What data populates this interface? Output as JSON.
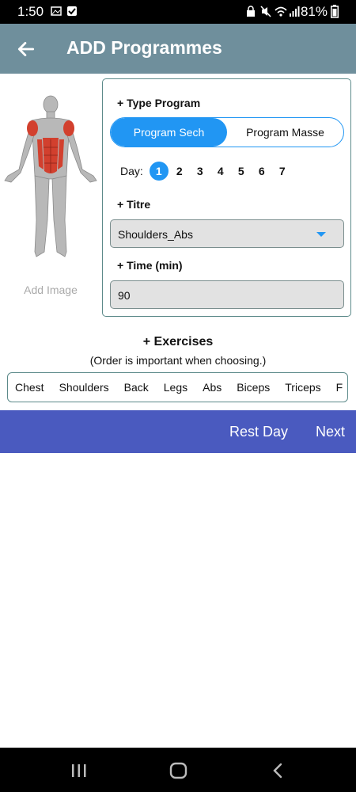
{
  "status": {
    "time": "1:50",
    "battery": "81%"
  },
  "header": {
    "title": "ADD Programmes"
  },
  "image": {
    "add_label": "Add Image"
  },
  "type_program": {
    "label": "+ Type Program",
    "options": [
      "Program Sech",
      "Program Masse"
    ],
    "selected": 0
  },
  "days": {
    "label": "Day:",
    "values": [
      "1",
      "2",
      "3",
      "4",
      "5",
      "6",
      "7"
    ],
    "selected": 0
  },
  "titre": {
    "label": "+ Titre",
    "value": "Shoulders_Abs"
  },
  "time": {
    "label": "+ Time (min)",
    "value": "90"
  },
  "exercises": {
    "title": "+ Exercises",
    "note": "(Order is important when choosing.)",
    "categories": [
      "Chest",
      "Shoulders",
      "Back",
      "Legs",
      "Abs",
      "Biceps",
      "Triceps",
      "F"
    ]
  },
  "actions": {
    "rest_day": "Rest Day",
    "next": "Next"
  },
  "colors": {
    "appbar": "#6f8f9c",
    "accent": "#2196f3",
    "action_bar": "#4a5abf"
  }
}
